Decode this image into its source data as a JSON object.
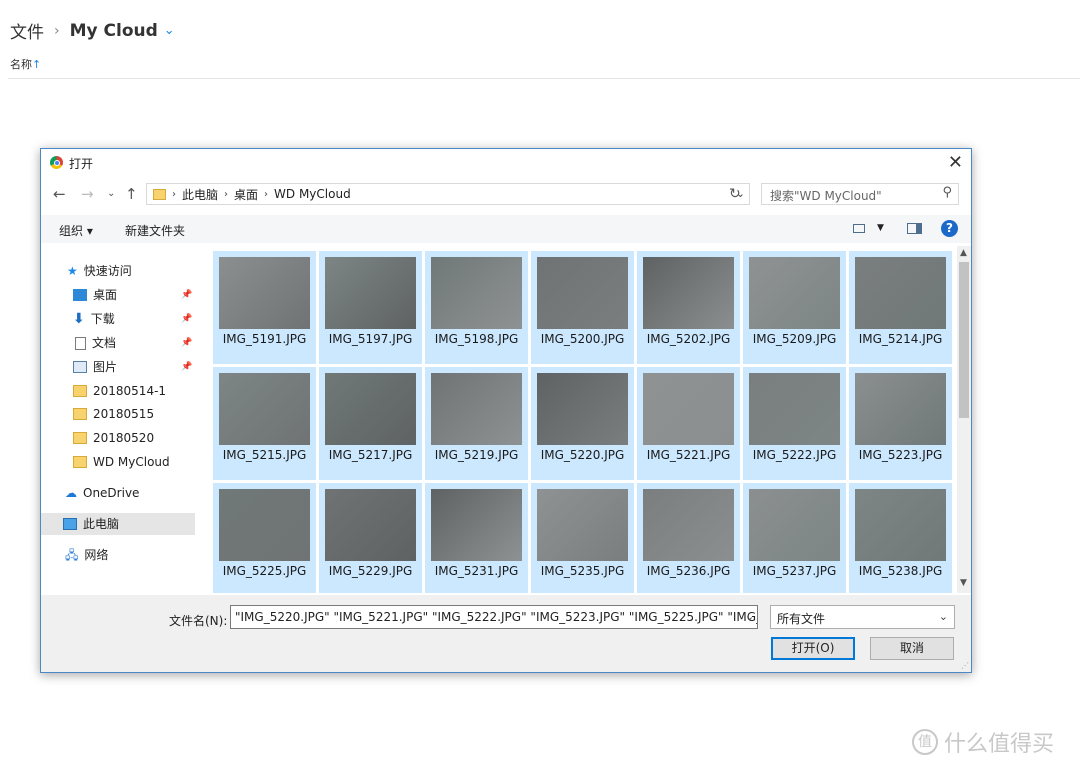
{
  "page": {
    "breadcrumb_root": "文件",
    "breadcrumb_sep": "›",
    "breadcrumb_current": "My Cloud",
    "breadcrumb_chevron": "⌄",
    "sort_label": "名称",
    "sort_arrow": "↑"
  },
  "dialog": {
    "title": "打开",
    "close": "✕",
    "address": {
      "crumbs": [
        "此电脑",
        "桌面",
        "WD MyCloud"
      ],
      "separator": "›"
    },
    "search_placeholder": "搜索\"WD MyCloud\"",
    "toolbar": {
      "organize": "组织 ▾",
      "new_folder": "新建文件夹",
      "help": "?"
    },
    "nav_pane": {
      "quick_access": "快速访问",
      "items": [
        "桌面",
        "下载",
        "文档",
        "图片",
        "20180514-1",
        "20180515",
        "20180520",
        "WD MyCloud"
      ],
      "onedrive": "OneDrive",
      "this_pc": "此电脑",
      "network": "网络"
    },
    "files": [
      "IMG_5191.JPG",
      "IMG_5197.JPG",
      "IMG_5198.JPG",
      "IMG_5200.JPG",
      "IMG_5202.JPG",
      "IMG_5209.JPG",
      "IMG_5214.JPG",
      "IMG_5215.JPG",
      "IMG_5217.JPG",
      "IMG_5219.JPG",
      "IMG_5220.JPG",
      "IMG_5221.JPG",
      "IMG_5222.JPG",
      "IMG_5223.JPG",
      "IMG_5225.JPG",
      "IMG_5229.JPG",
      "IMG_5231.JPG",
      "IMG_5235.JPG",
      "IMG_5236.JPG",
      "IMG_5237.JPG",
      "IMG_5238.JPG"
    ],
    "filename_label": "文件名(N):",
    "filename_value": "\"IMG_5220.JPG\" \"IMG_5221.JPG\" \"IMG_5222.JPG\" \"IMG_5223.JPG\" \"IMG_5225.JPG\" \"IMG_",
    "filetype": "所有文件",
    "open_button": "打开(O)",
    "cancel_button": "取消"
  },
  "watermark": {
    "icon_text": "值",
    "text": "什么值得买"
  },
  "colors": {
    "accent": "#1e88e5",
    "selection": "#cce8ff",
    "dialog_border": "#4a88c8"
  }
}
